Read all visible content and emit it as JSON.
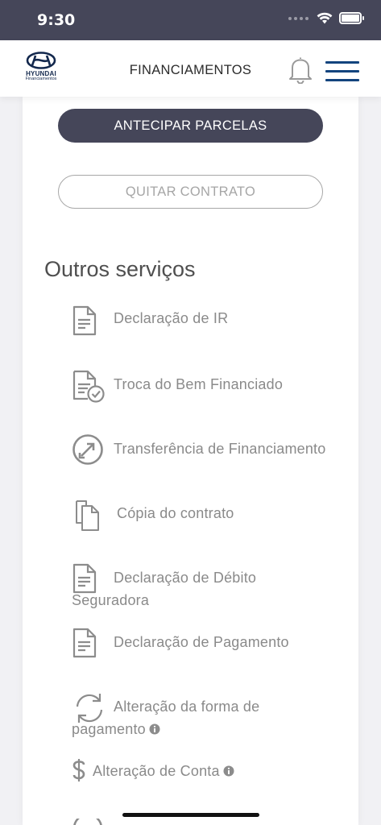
{
  "status_bar": {
    "time": "9:30"
  },
  "header": {
    "logo_brand": "HYUNDAI",
    "logo_subtitle": "Financiamentos",
    "title": "FINANCIAMENTOS"
  },
  "actions": {
    "anticipate": "ANTECIPAR PARCELAS",
    "settle": "QUITAR CONTRATO"
  },
  "section_title": "Outros serviços",
  "services": [
    {
      "label": "Declaração de IR",
      "icon": "document-icon"
    },
    {
      "label": "Troca do Bem Financiado",
      "icon": "document-check-icon"
    },
    {
      "label": "Transferência de Financiamento",
      "icon": "transfer-icon"
    },
    {
      "label": "Cópia do contrato",
      "icon": "copy-document-icon"
    },
    {
      "label": "Declaração de Débito Seguradora",
      "icon": "document-icon"
    },
    {
      "label": "Declaração de Pagamento",
      "icon": "document-icon"
    },
    {
      "label": "Alteração da forma de pagamento",
      "icon": "refresh-icon",
      "info": true
    },
    {
      "label": "Alteração de Conta",
      "icon": "dollar-icon",
      "info": true
    }
  ],
  "colors": {
    "primary_dark": "#454659",
    "brand_blue": "#13447e",
    "text_gray": "#8a8a8a"
  }
}
